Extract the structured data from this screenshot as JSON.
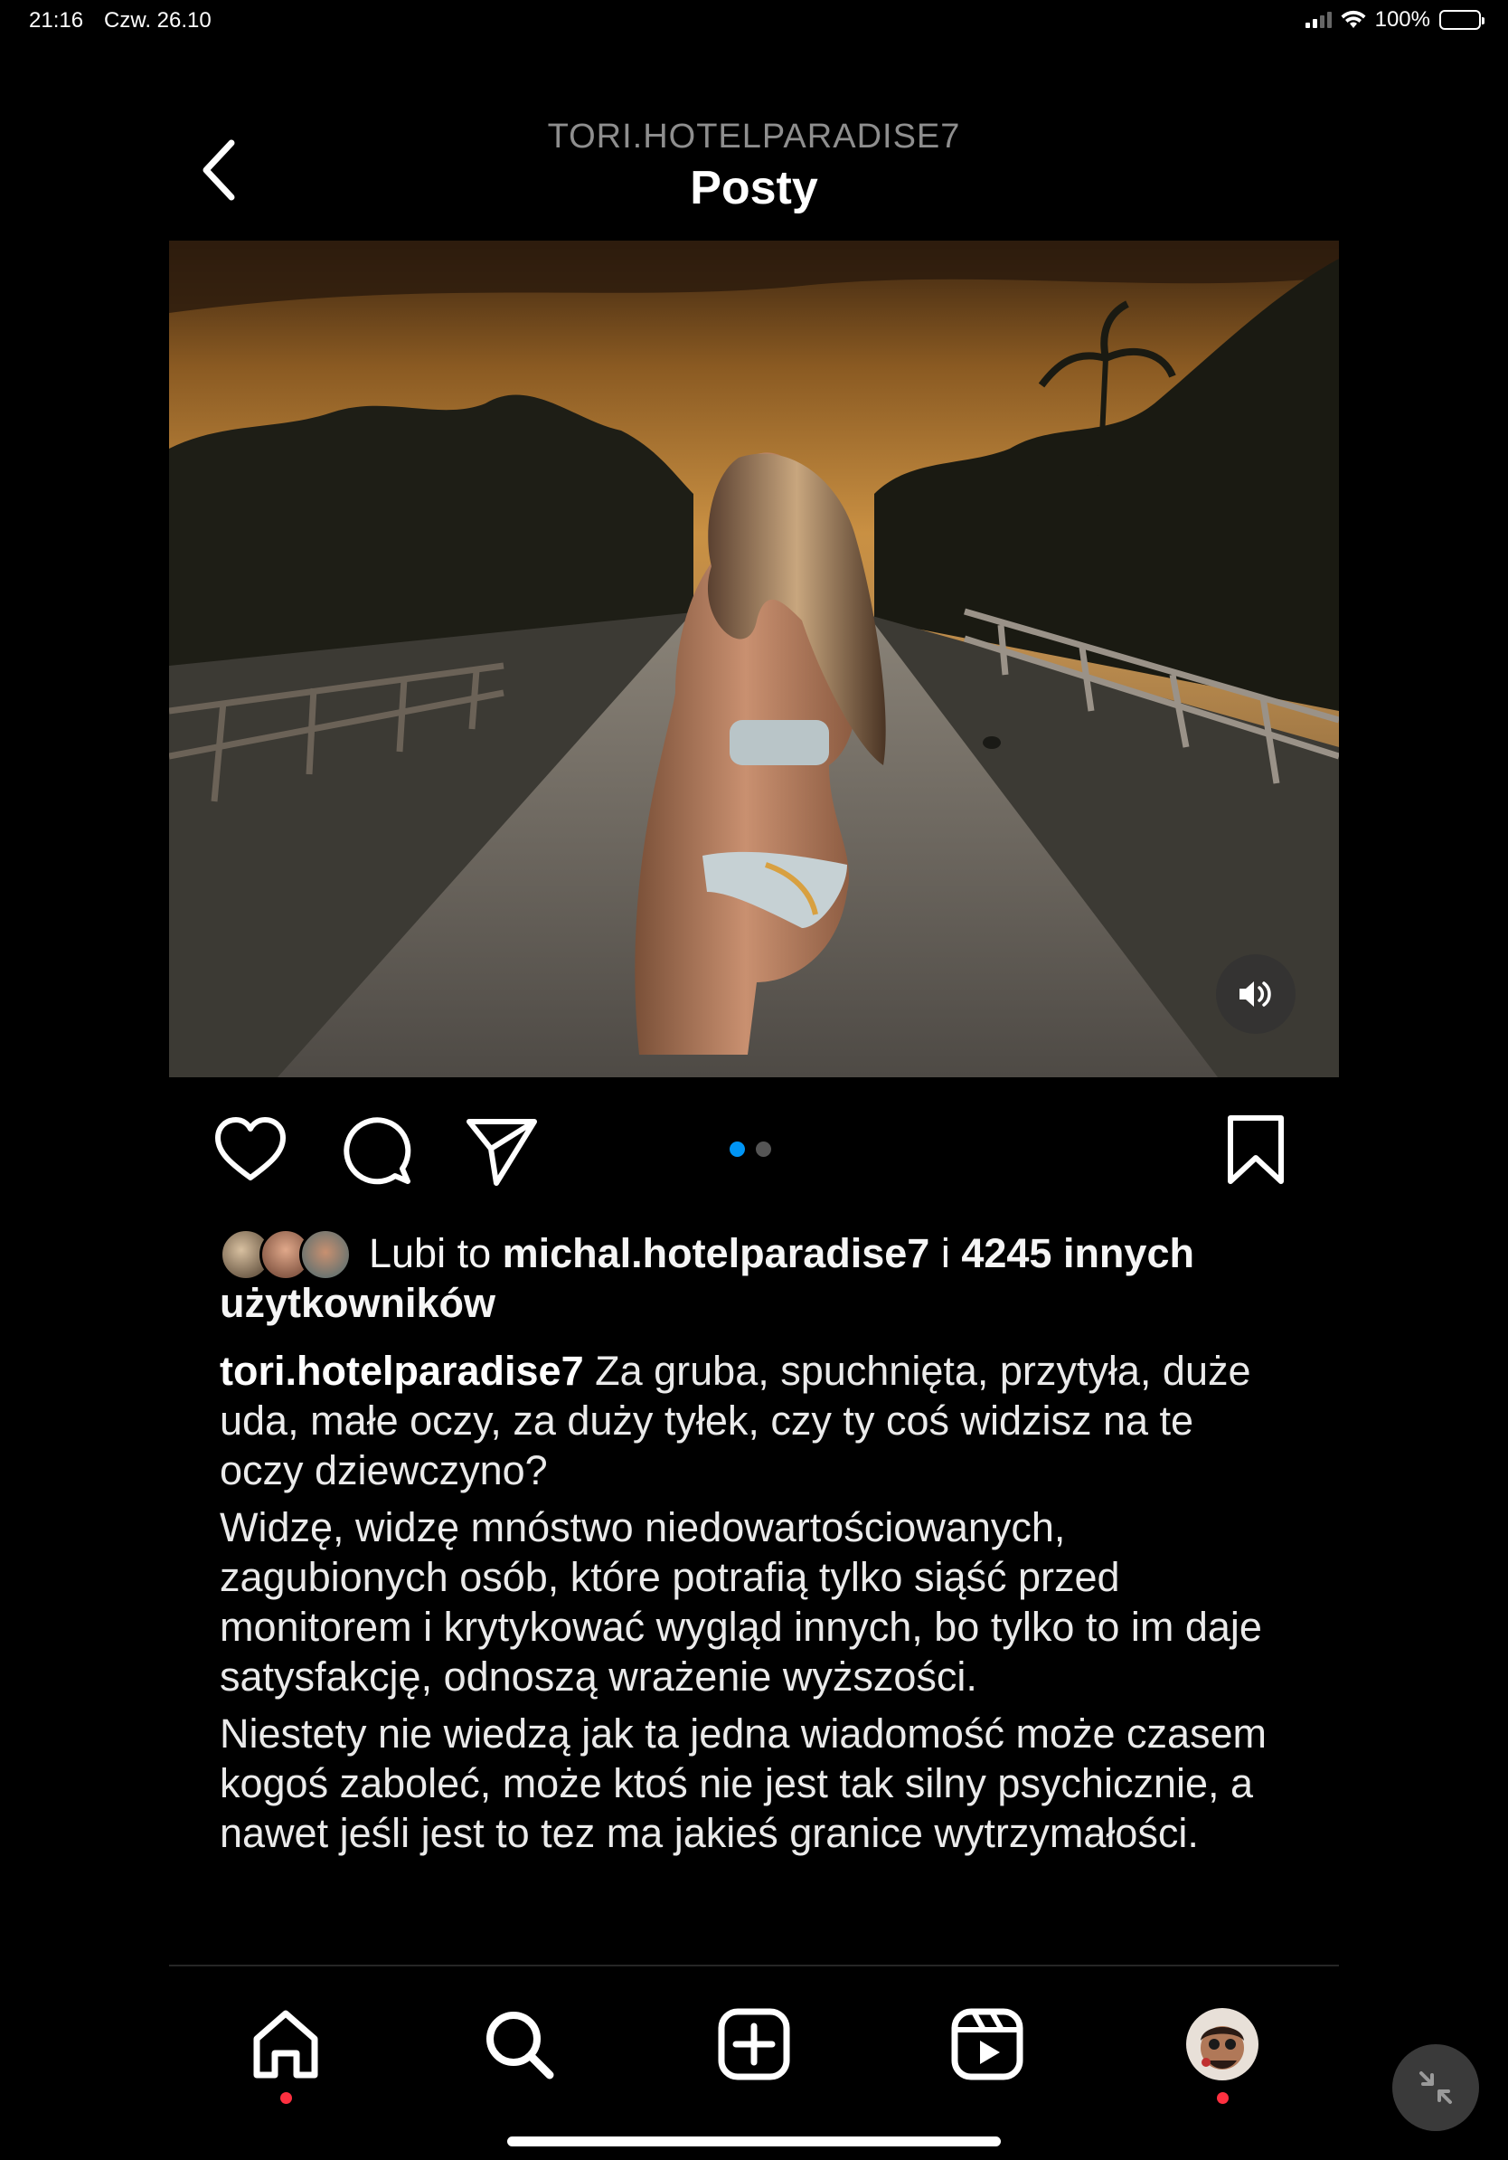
{
  "status_bar": {
    "time": "21:16",
    "date": "Czw. 26.10",
    "battery": "100%",
    "icons": [
      "signal-icon",
      "wifi-icon",
      "battery-icon"
    ]
  },
  "header": {
    "username": "TORI.HOTELPARADISE7",
    "title": "Posty",
    "back_icon": "chevron-left-icon"
  },
  "post": {
    "media_description_icon": "volume-icon",
    "carousel": {
      "count": 2,
      "active": 1
    },
    "actions": [
      "heart-icon",
      "comment-icon",
      "share-icon",
      "bookmark-icon"
    ],
    "likes": {
      "prefix": "Lubi to ",
      "user": "michal.hotelparadise7",
      "middle": " i ",
      "others": "4245 innych użytkowników"
    },
    "caption": {
      "author": "tori.hotelparadise7",
      "p1": " Za gruba, spuchnięta, przytyła, duże uda, małe oczy, za duży tyłek, czy ty coś widzisz na te oczy dziewczyno?",
      "p2": "Widzę, widzę mnóstwo niedowartościowanych, zagubionych osób, które potrafią tylko siąść przed monitorem i krytykować wygląd innych, bo tylko to im daje satysfakcję, odnoszą wrażenie wyższości.",
      "p3": "Niestety nie wiedzą jak ta jedna wiadomość może czasem kogoś zaboleć, może ktoś nie jest tak silny psychicznie, a nawet jeśli jest to tez ma jakieś granice wytrzymałości."
    }
  },
  "bottom_nav": {
    "items": [
      "home-icon",
      "search-icon",
      "create-icon",
      "reels-icon",
      "profile-avatar"
    ]
  },
  "colors": {
    "background": "#000000",
    "accent": "#0095f6",
    "notification": "#ff3040",
    "muted_text": "#8e8e8e"
  }
}
